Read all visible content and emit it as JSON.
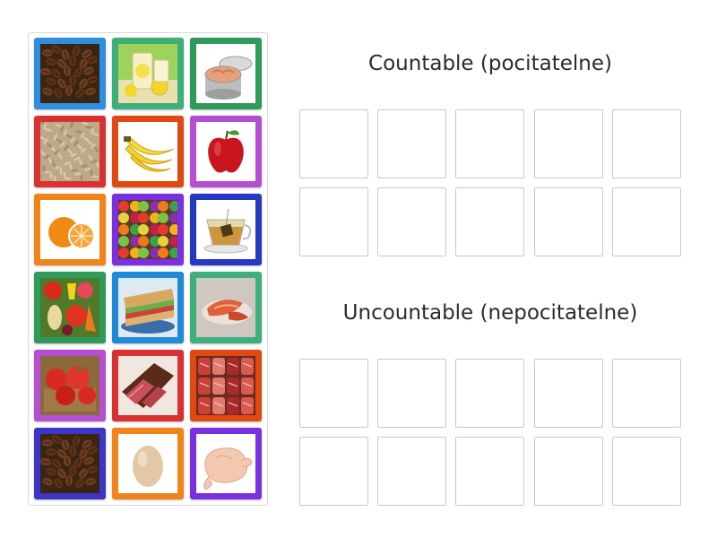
{
  "groups": [
    {
      "title": "Countable (pocitatelne)",
      "slots": 10
    },
    {
      "title": "Uncountable (nepocitatelne)",
      "slots": 10
    }
  ],
  "colors": {
    "blue": "#2e8fe0",
    "green": "#2f9a5a",
    "red": "#d93131",
    "orange": "#f0841a",
    "purple": "#8a3de0",
    "navy": "#2438c2",
    "teal": "#3eae7a",
    "magenta": "#b34fd0",
    "vermilion": "#e04a12",
    "indigo": "#3d34c8",
    "violet": "#7a2fe0",
    "sky": "#1f8ad8"
  },
  "cards": [
    {
      "icon": "coffee-beans-icon",
      "frame": "blue"
    },
    {
      "icon": "lemonade-icon",
      "frame": "teal"
    },
    {
      "icon": "tuna-can-icon",
      "frame": "green"
    },
    {
      "icon": "rice-icon",
      "frame": "red"
    },
    {
      "icon": "bananas-icon",
      "frame": "vermilion"
    },
    {
      "icon": "apple-icon",
      "frame": "magenta"
    },
    {
      "icon": "orange-icon",
      "frame": "orange"
    },
    {
      "icon": "mixed-fruit-icon",
      "frame": "violet"
    },
    {
      "icon": "tea-cup-icon",
      "frame": "navy"
    },
    {
      "icon": "vegetables-icon",
      "frame": "green"
    },
    {
      "icon": "sandwich-icon",
      "frame": "sky"
    },
    {
      "icon": "salmon-icon",
      "frame": "teal"
    },
    {
      "icon": "tomatoes-icon",
      "frame": "magenta"
    },
    {
      "icon": "roast-beef-icon",
      "frame": "red"
    },
    {
      "icon": "meat-icon",
      "frame": "vermilion"
    },
    {
      "icon": "coffee-beans-icon",
      "frame": "indigo"
    },
    {
      "icon": "egg-icon",
      "frame": "orange"
    },
    {
      "icon": "chicken-icon",
      "frame": "violet"
    }
  ]
}
